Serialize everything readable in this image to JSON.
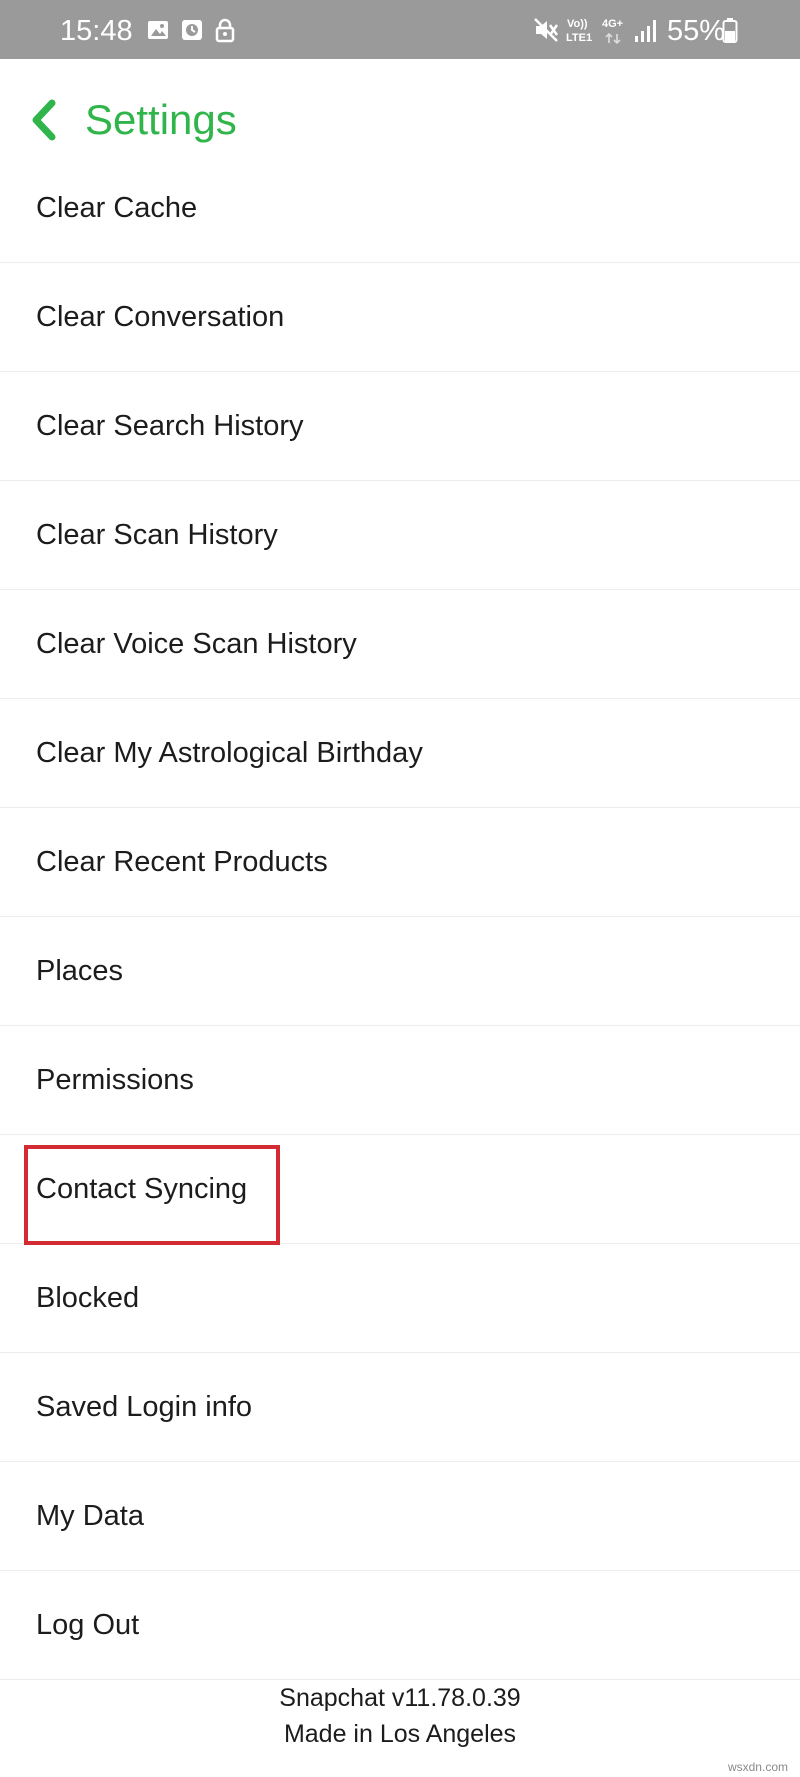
{
  "status_bar": {
    "time": "15:48",
    "volte_top": "Vo))",
    "volte_bottom": "LTE1",
    "network": "4G+",
    "battery": "55%",
    "icons": [
      "image-icon",
      "clock-app-icon",
      "lock-icon",
      "mute-icon",
      "signal-icon",
      "battery-icon"
    ]
  },
  "header": {
    "title": "Settings",
    "back_icon": "chevron-left-icon",
    "accent_color": "#2fb54a"
  },
  "settings_items": [
    {
      "label": "Clear Cache"
    },
    {
      "label": "Clear Conversation"
    },
    {
      "label": "Clear Search History"
    },
    {
      "label": "Clear Scan History"
    },
    {
      "label": "Clear Voice Scan History"
    },
    {
      "label": "Clear My Astrological Birthday"
    },
    {
      "label": "Clear Recent Products"
    },
    {
      "label": "Places"
    },
    {
      "label": "Permissions"
    },
    {
      "label": "Contact Syncing",
      "highlighted": true
    },
    {
      "label": "Blocked"
    },
    {
      "label": "Saved Login info"
    },
    {
      "label": "My Data"
    },
    {
      "label": "Log Out"
    }
  ],
  "highlight_color": "#d22b34",
  "footer": {
    "version": "Snapchat v11.78.0.39",
    "origin": "Made in Los Angeles"
  },
  "watermark": "wsxdn.com"
}
